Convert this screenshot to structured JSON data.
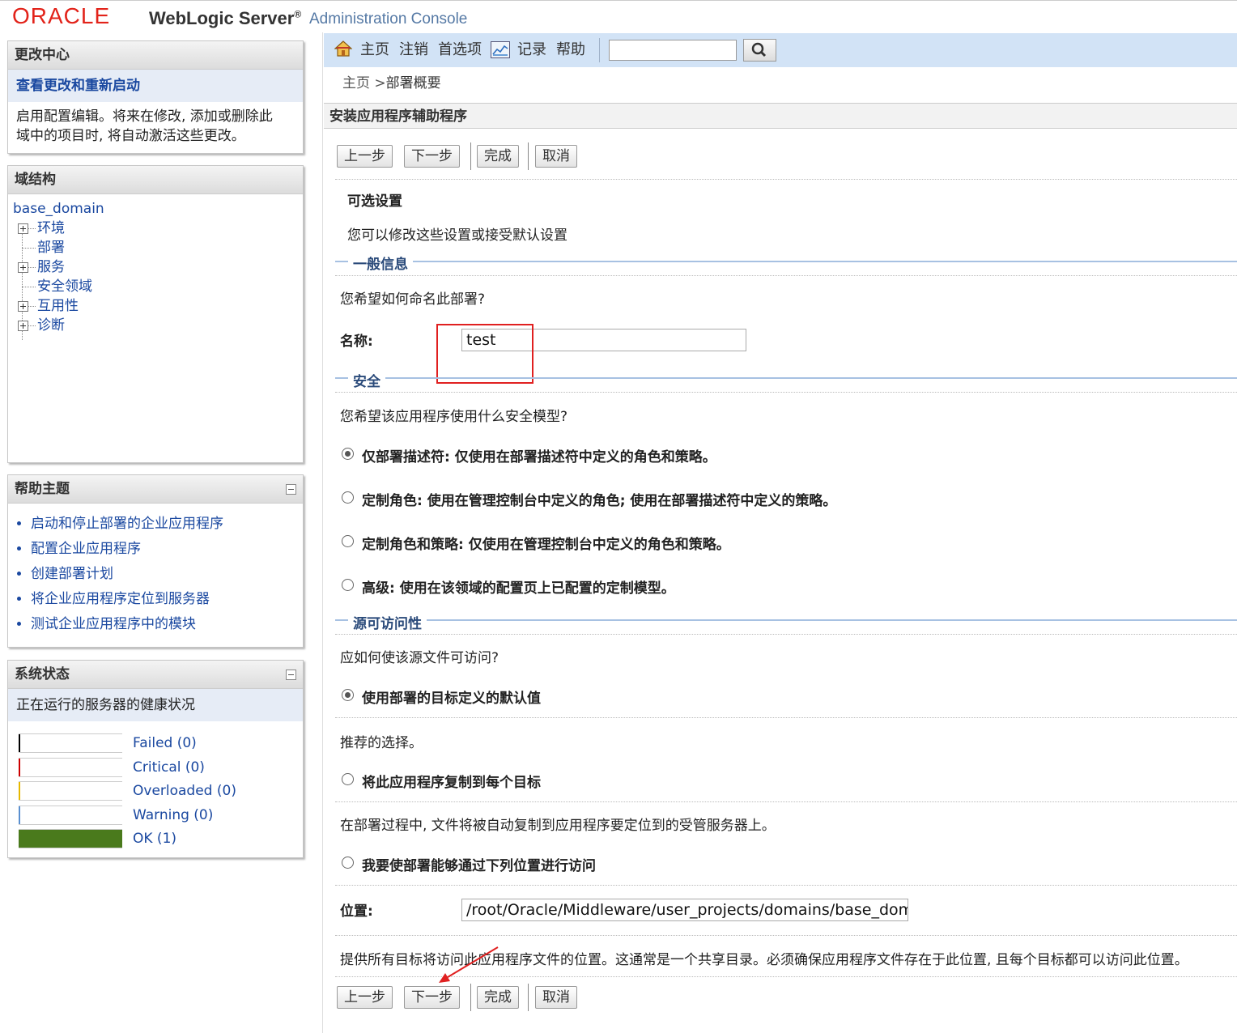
{
  "header": {
    "brand": "ORACLE",
    "product": "WebLogic Server",
    "product_mark": "®",
    "console": "Administration Console"
  },
  "change_center": {
    "title": "更改中心",
    "link": "查看更改和重新启动",
    "desc_line1": "启用配置编辑。将来在修改, 添加或删除此",
    "desc_line2": "域中的项目时, 将自动激活这些更改。"
  },
  "domain_structure": {
    "title": "域结构",
    "root": "base_domain",
    "items": [
      {
        "label": "环境",
        "expandable": true
      },
      {
        "label": "部署",
        "expandable": false
      },
      {
        "label": "服务",
        "expandable": true
      },
      {
        "label": "安全领域",
        "expandable": false
      },
      {
        "label": "互用性",
        "expandable": true
      },
      {
        "label": "诊断",
        "expandable": true
      }
    ]
  },
  "help_topics": {
    "title": "帮助主题",
    "items": [
      "启动和停止部署的企业应用程序",
      "配置企业应用程序",
      "创建部署计划",
      "将企业应用程序定位到服务器",
      "测试企业应用程序中的模块"
    ]
  },
  "system_status": {
    "title": "系统状态",
    "subtitle": "正在运行的服务器的健康状况",
    "rows": [
      {
        "label": "Failed (0)",
        "color": "#000000",
        "fraction": 0
      },
      {
        "label": "Critical (0)",
        "color": "#cc0000",
        "fraction": 0
      },
      {
        "label": "Overloaded (0)",
        "color": "#e6b800",
        "fraction": 0
      },
      {
        "label": "Warning (0)",
        "color": "#5a8fd0",
        "fraction": 0
      },
      {
        "label": "OK (1)",
        "color": "#4a7a1c",
        "fraction": 1
      }
    ]
  },
  "toolbar": {
    "home": "主页",
    "logout": "注销",
    "preferences": "首选项",
    "record": "记录",
    "help": "帮助",
    "search_value": ""
  },
  "breadcrumb": {
    "home": "主页",
    "sep": ">",
    "current": "部署概要"
  },
  "main": {
    "title": "安装应用程序辅助程序",
    "buttons": {
      "back": "上一步",
      "next": "下一步",
      "finish": "完成",
      "cancel": "取消"
    },
    "optional_settings": "可选设置",
    "intro": "您可以修改这些设置或接受默认设置",
    "general": {
      "heading": "一般信息",
      "question": "您希望如何命名此部署?",
      "name_label": "名称:",
      "name_value": "test"
    },
    "security": {
      "heading": "安全",
      "question": "您希望该应用程序使用什么安全模型?",
      "options": [
        {
          "label": "仅部署描述符: 仅使用在部署描述符中定义的角色和策略。",
          "checked": true
        },
        {
          "label": "定制角色: 使用在管理控制台中定义的角色; 使用在部署描述符中定义的策略。",
          "checked": false
        },
        {
          "label": "定制角色和策略: 仅使用在管理控制台中定义的角色和策略。",
          "checked": false
        },
        {
          "label": "高级: 使用在该领域的配置页上已配置的定制模型。",
          "checked": false
        }
      ]
    },
    "source": {
      "heading": "源可访问性",
      "question": "应如何使该源文件可访问?",
      "opt1": "使用部署的目标定义的默认值",
      "opt1_checked": true,
      "opt1_note": "推荐的选择。",
      "opt2": "将此应用程序复制到每个目标",
      "opt2_checked": false,
      "opt2_note": "在部署过程中, 文件将被自动复制到应用程序要定位到的受管服务器上。",
      "opt3": "我要使部署能够通过下列位置进行访问",
      "opt3_checked": false,
      "location_label": "位置:",
      "location_value": "/root/Oracle/Middleware/user_projects/domains/base_domain",
      "location_note": "提供所有目标将访问此应用程序文件的位置。这通常是一个共享目录。必须确保应用程序文件存在于此位置, 且每个目标都可以访问此位置。"
    }
  },
  "colors": {
    "link": "#1a48a0",
    "highlight_box": "#e02020",
    "toolbar_bg": "#d2e3f6",
    "section_line": "#a7c1e2"
  }
}
